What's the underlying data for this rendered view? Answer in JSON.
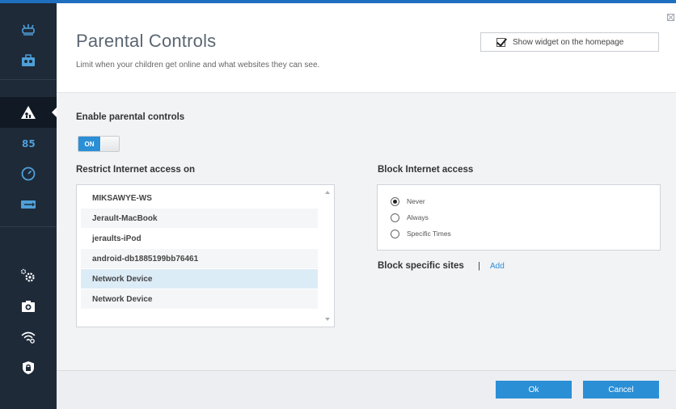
{
  "header": {
    "title": "Parental Controls",
    "subtitle": "Limit when your children get online and what websites they can see.",
    "widget_checkbox": {
      "label": "Show widget on the homepage",
      "checked": true
    }
  },
  "sidebar": {
    "items": [
      {
        "name": "network-map-icon",
        "active": false
      },
      {
        "name": "guest-access-icon",
        "active": false
      },
      {
        "name": "parental-controls-icon",
        "active": true
      },
      {
        "name": "media-prioritization-icon",
        "active": false
      },
      {
        "name": "speed-test-icon",
        "active": false
      },
      {
        "name": "external-storage-icon",
        "active": false
      },
      {
        "name": "connectivity-icon",
        "active": false
      },
      {
        "name": "troubleshooting-icon",
        "active": false
      },
      {
        "name": "wireless-icon",
        "active": false
      },
      {
        "name": "security-icon",
        "active": false
      }
    ]
  },
  "enable": {
    "label": "Enable parental controls",
    "toggle_text": "ON",
    "enabled": true
  },
  "restrict": {
    "label": "Restrict Internet access on",
    "devices": [
      {
        "name": "MIKSAWYE-WS",
        "selected": false
      },
      {
        "name": "Jerault-MacBook",
        "selected": false
      },
      {
        "name": "jeraults-iPod",
        "selected": false
      },
      {
        "name": "android-db1885199bb76461",
        "selected": false
      },
      {
        "name": "Network Device",
        "selected": true
      },
      {
        "name": "Network Device",
        "selected": false
      }
    ]
  },
  "block": {
    "label": "Block Internet access",
    "options": [
      {
        "label": "Never",
        "checked": true
      },
      {
        "label": "Always",
        "checked": false
      },
      {
        "label": "Specific Times",
        "checked": false
      }
    ]
  },
  "sites": {
    "label": "Block specific sites",
    "separator": "|",
    "add_label": "Add"
  },
  "footer": {
    "ok_label": "Ok",
    "cancel_label": "Cancel"
  },
  "colors": {
    "accent": "#2b8fd6",
    "sidebar_bg": "#1e2a38",
    "selected_row": "#dcecf7"
  }
}
